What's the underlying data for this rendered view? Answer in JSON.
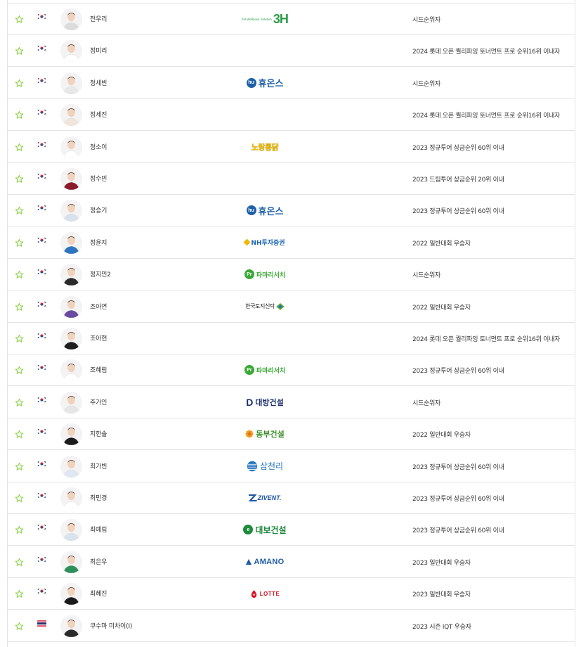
{
  "rows": [
    {
      "name": "전우리",
      "country": "korea",
      "avatar_shirt": "#dcdcdc",
      "sponsor": "3H",
      "qualification": "시드순위자"
    },
    {
      "name": "정미리",
      "country": "korea",
      "avatar_shirt": "#ffffff",
      "sponsor": "",
      "qualification": "2024 롯데 오픈 퀄리파잉 토너먼트 프로 순위16위 이내자"
    },
    {
      "name": "정세빈",
      "country": "korea",
      "avatar_shirt": "#e8e8e8",
      "sponsor": "휴온스",
      "qualification": "시드순위자"
    },
    {
      "name": "정세진",
      "country": "korea",
      "avatar_shirt": "#f2e6dc",
      "sponsor": "",
      "qualification": "2024 롯데 오픈 퀄리파잉 토너먼트 프로 순위16위 이내자"
    },
    {
      "name": "정소이",
      "country": "korea",
      "avatar_shirt": "#ffffff",
      "sponsor": "노랑통닭",
      "qualification": "2023 정규투어 상금순위 60위 이내"
    },
    {
      "name": "정수빈",
      "country": "korea",
      "avatar_shirt": "#8a1c2a",
      "sponsor": "",
      "qualification": "2023 드림투어 상금순위 20위 이내"
    },
    {
      "name": "정승기",
      "country": "korea",
      "avatar_shirt": "#d8e2ec",
      "sponsor": "휴온스",
      "qualification": "2023 정규투어 상금순위 60위 이내"
    },
    {
      "name": "정윤지",
      "country": "korea",
      "avatar_shirt": "#2f74c0",
      "sponsor": "NH투자증권",
      "qualification": "2022 일반대회 우승자"
    },
    {
      "name": "정지민2",
      "country": "korea",
      "avatar_shirt": "#2a2a2a",
      "sponsor": "파마리서치",
      "qualification": "시드순위자"
    },
    {
      "name": "조아연",
      "country": "korea",
      "avatar_shirt": "#6a4aa0",
      "sponsor": "한국토지신탁",
      "qualification": "2022 일반대회 우승자"
    },
    {
      "name": "조아현",
      "country": "korea",
      "avatar_shirt": "#1e1e1e",
      "sponsor": "",
      "qualification": "2024 롯데 오픈 퀄리파잉 토너먼트 프로 순위16위 이내자"
    },
    {
      "name": "조혜림",
      "country": "korea",
      "avatar_shirt": "#ffffff",
      "sponsor": "파마리서치",
      "qualification": "2023 정규투어 상금순위 60위 이내"
    },
    {
      "name": "주가인",
      "country": "korea",
      "avatar_shirt": "#e6e6e6",
      "sponsor": "대방건설",
      "qualification": "시드순위자"
    },
    {
      "name": "지한솔",
      "country": "korea",
      "avatar_shirt": "#1a1a1a",
      "sponsor": "동부건설",
      "qualification": "2022 일반대회 우승자"
    },
    {
      "name": "최가빈",
      "country": "korea",
      "avatar_shirt": "#dfe8f2",
      "sponsor": "삼천리",
      "qualification": "2023 정규투어 상금순위 60위 이내"
    },
    {
      "name": "최민경",
      "country": "korea",
      "avatar_shirt": "#ffffff",
      "sponsor": "ZIVENT",
      "qualification": "2023 정규투어 상금순위 60위 이내"
    },
    {
      "name": "최예림",
      "country": "korea",
      "avatar_shirt": "#d9e3ee",
      "sponsor": "대보건설",
      "qualification": "2023 정규투어 상금순위 60위 이내"
    },
    {
      "name": "최은우",
      "country": "korea",
      "avatar_shirt": "#2f8f5a",
      "sponsor": "AMANO",
      "qualification": "2023 일반대회 우승자"
    },
    {
      "name": "최혜진",
      "country": "korea",
      "avatar_shirt": "#1a1a1a",
      "sponsor": "LOTTE",
      "qualification": "2023 일반대회 우승자"
    },
    {
      "name": "쿠수마 미차이(I)",
      "country": "thailand",
      "avatar_shirt": "#2a2a2a",
      "sponsor": "",
      "qualification": "2023 시즌 IQT 우승자"
    }
  ],
  "sponsor_logos": {
    "3H": {
      "small_text": "3H Wellness Solution",
      "big_text": "3H",
      "color": "#2e9b4a"
    },
    "휴온스": {
      "text": "휴온스",
      "badge": "hu",
      "color": "#1d5fa8"
    },
    "노랑통닭": {
      "text": "노랑통닭",
      "color": "#f2c200"
    },
    "NH투자증권": {
      "text": "NH투자증권",
      "color": "#1b66b3"
    },
    "파마리서치": {
      "text": "파마리서치",
      "badge": "Pr",
      "color": "#3aa935"
    },
    "한국토지신탁": {
      "text": "한국토지신탁",
      "color": "#222222"
    },
    "대방건설": {
      "text": "대방건설",
      "badge": "D",
      "color": "#1c2f6e"
    },
    "동부건설": {
      "text": "동부건설",
      "color": "#3d8f2a"
    },
    "삼천리": {
      "text": "삼천리",
      "color": "#1e73be"
    },
    "ZIVENT": {
      "text": "ZIVENT.",
      "color": "#1f55a6"
    },
    "대보건설": {
      "text": "대보건설",
      "badge": "e",
      "color": "#1d8a3c"
    },
    "AMANO": {
      "text": "AMANO",
      "color": "#1e5aa8"
    },
    "LOTTE": {
      "text": "LOTTE",
      "color": "#d6111f"
    }
  },
  "colors": {
    "star": "#8fd14f",
    "border": "#e3e3e3",
    "text": "#333333"
  }
}
